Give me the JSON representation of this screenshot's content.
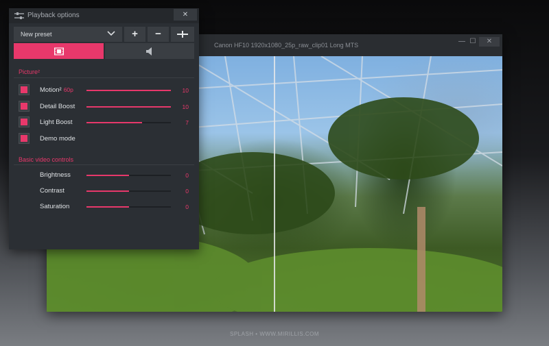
{
  "video_window": {
    "title": "Canon HF10 1920x1080_25p_raw_clip01 Long MTS",
    "minimize_glyph": "—",
    "maximize_glyph": "☐",
    "close_glyph": "✕"
  },
  "panel": {
    "title": "Playback options",
    "close_glyph": "✕",
    "preset": {
      "selected": "New preset"
    },
    "toolbar": {
      "add_glyph": "+",
      "remove_glyph": "−",
      "split_glyph": "-I-"
    },
    "tabs": [
      {
        "id": "video",
        "icon": "film-icon",
        "active": true
      },
      {
        "id": "audio",
        "icon": "speaker-icon",
        "active": false
      }
    ],
    "sections": {
      "picture": {
        "title": "Picture²",
        "rows": [
          {
            "label": "Motion²",
            "sub": "60p",
            "checked": true,
            "slider": 1.0,
            "value": "10"
          },
          {
            "label": "Detail Boost",
            "sub": "",
            "checked": true,
            "slider": 1.0,
            "value": "10"
          },
          {
            "label": "Light Boost",
            "sub": "",
            "checked": true,
            "slider": 0.66,
            "value": "7"
          },
          {
            "label": "Demo mode",
            "checked": true
          }
        ]
      },
      "basic": {
        "title": "Basic video controls",
        "rows": [
          {
            "label": "Brightness",
            "slider": 0.5,
            "value": "0"
          },
          {
            "label": "Contrast",
            "slider": 0.5,
            "value": "0"
          },
          {
            "label": "Saturation",
            "slider": 0.5,
            "value": "0"
          }
        ]
      }
    }
  },
  "colors": {
    "accent": "#e8386b",
    "panel_bg": "#2b2f34",
    "control_bg": "#3a3e43"
  },
  "footer": {
    "text": "SPLASH • WWW.MIRILLIS.COM"
  }
}
